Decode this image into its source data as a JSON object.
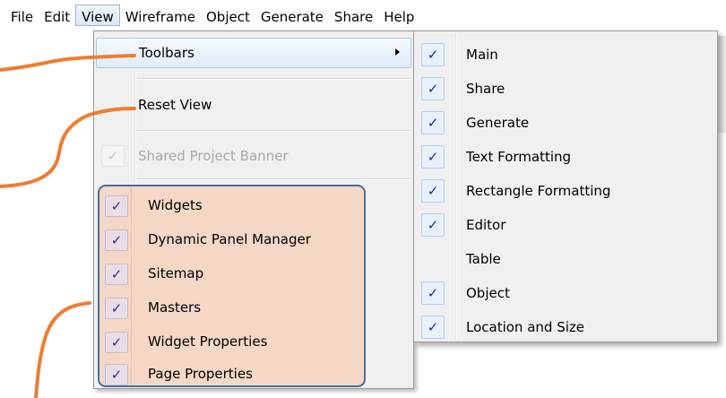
{
  "menubar": {
    "items": [
      "File",
      "Edit",
      "View",
      "Wireframe",
      "Object",
      "Generate",
      "Share",
      "Help"
    ],
    "active_index": 2
  },
  "view_menu": {
    "toolbars": "Toolbars",
    "reset_view": "Reset View",
    "shared_project_banner": "Shared Project Banner",
    "panes": [
      {
        "label": "Widgets",
        "checked": true
      },
      {
        "label": "Dynamic Panel Manager",
        "checked": true
      },
      {
        "label": "Sitemap",
        "checked": true
      },
      {
        "label": "Masters",
        "checked": true
      },
      {
        "label": "Widget Properties",
        "checked": true
      },
      {
        "label": "Page Properties",
        "checked": true
      }
    ]
  },
  "toolbars_submenu": {
    "items": [
      {
        "label": "Main",
        "checked": true
      },
      {
        "label": "Share",
        "checked": true
      },
      {
        "label": "Generate",
        "checked": true
      },
      {
        "label": "Text Formatting",
        "checked": true
      },
      {
        "label": "Rectangle Formatting",
        "checked": true
      },
      {
        "label": "Editor",
        "checked": true
      },
      {
        "label": "Table",
        "checked": false
      },
      {
        "label": "Object",
        "checked": true
      },
      {
        "label": "Location and Size",
        "checked": true
      }
    ]
  },
  "glyphs": {
    "check": "✓"
  },
  "colors": {
    "callout": "#ed7d31",
    "group_fill": "#f4d8c5",
    "group_border": "#4a6e9b",
    "highlight": "#e1ecf8"
  }
}
